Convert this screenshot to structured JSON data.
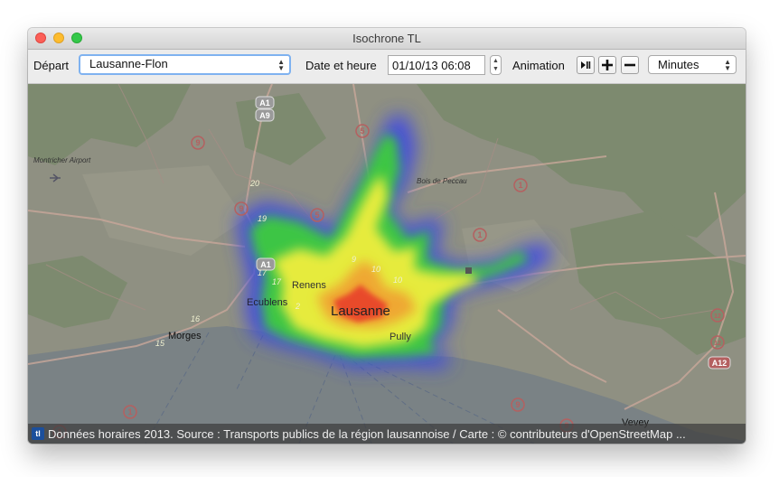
{
  "window": {
    "title": "Isochrone TL"
  },
  "toolbar": {
    "depart_label": "Départ",
    "depart_value": "Lausanne-Flon",
    "date_label": "Date et heure",
    "date_value": "01/10/13 06:08",
    "animation_label": "Animation",
    "play_pause_icon": "play-pause-icon",
    "zoom_in_icon": "plus-icon",
    "zoom_out_icon": "minus-icon",
    "unit_value": "Minutes"
  },
  "map": {
    "labels": {
      "lausanne": "Lausanne",
      "renens": "Renens",
      "ecublens": "Ecublens",
      "pully": "Pully",
      "morges": "Morges",
      "vevey": "Vevey",
      "airport": "Montricher Airport",
      "bois": "Bois de Peccau"
    },
    "road_shields": {
      "a1": "A1",
      "a9": "A9",
      "a1b": "A1",
      "a12": "A12",
      "r5a": "5",
      "r5b": "5",
      "r9a": "9",
      "r9b": "9",
      "r9c": "9",
      "r9d": "9",
      "r1a": "1",
      "r1b": "1",
      "r1c": "1",
      "r1d": "1",
      "r12": "12",
      "r12b": "12",
      "r1e": "1"
    },
    "iso_numbers": [
      "19",
      "17",
      "16",
      "15",
      "20",
      "9",
      "10",
      "10",
      "2",
      "17"
    ],
    "colors": {
      "iso_outer": "#3c46e6",
      "iso_mid": "#3ccc3c",
      "iso_inner": "#f0ee3c",
      "iso_core": "#e8402a",
      "lake": "#7a8285",
      "land": "#8f9082"
    }
  },
  "footer": {
    "logo_text": "tl",
    "attribution": "Données horaires 2013. Source : Transports publics de la région lausannoise / Carte : © contributeurs d'OpenStreetMap ..."
  }
}
